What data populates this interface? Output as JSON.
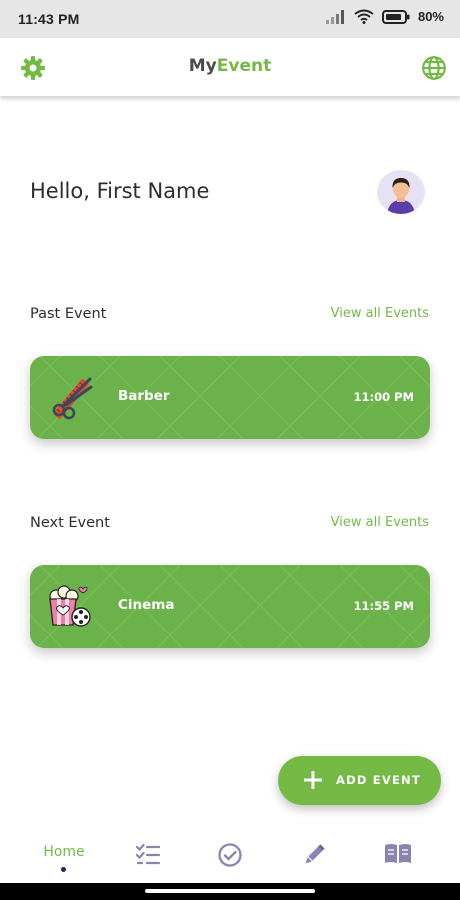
{
  "status_bar": {
    "time": "11:43 PM",
    "battery": "80%",
    "icons": [
      "signal-icon",
      "wifi-icon",
      "battery-icon"
    ]
  },
  "app_bar": {
    "title_part1": "My",
    "title_part2": "Event",
    "left_icon": "gear-icon",
    "right_icon": "globe-icon"
  },
  "greeting": "Hello, First Name",
  "past_section": {
    "title": "Past Event",
    "view_all": "View all Events",
    "event": {
      "name": "Barber",
      "time": "11:00 PM",
      "icon": "scissors-comb-icon"
    }
  },
  "next_section": {
    "title": "Next Event",
    "view_all": "View all Events",
    "event": {
      "name": "Cinema",
      "time": "11:55 PM",
      "icon": "popcorn-film-icon"
    }
  },
  "fab": {
    "label": "ADD EVENT",
    "icon": "plus-icon"
  },
  "bottom_nav": {
    "items": [
      {
        "label": "Home",
        "icon": "home",
        "active": true
      },
      {
        "icon": "checklist-icon"
      },
      {
        "icon": "check-circle-icon"
      },
      {
        "icon": "pencil-icon"
      },
      {
        "icon": "book-icon"
      }
    ]
  },
  "colors": {
    "accent": "#74b944",
    "card": "#6cb24a",
    "nav_icon": "#8a84b0",
    "title_dark": "#4b4b4b"
  }
}
